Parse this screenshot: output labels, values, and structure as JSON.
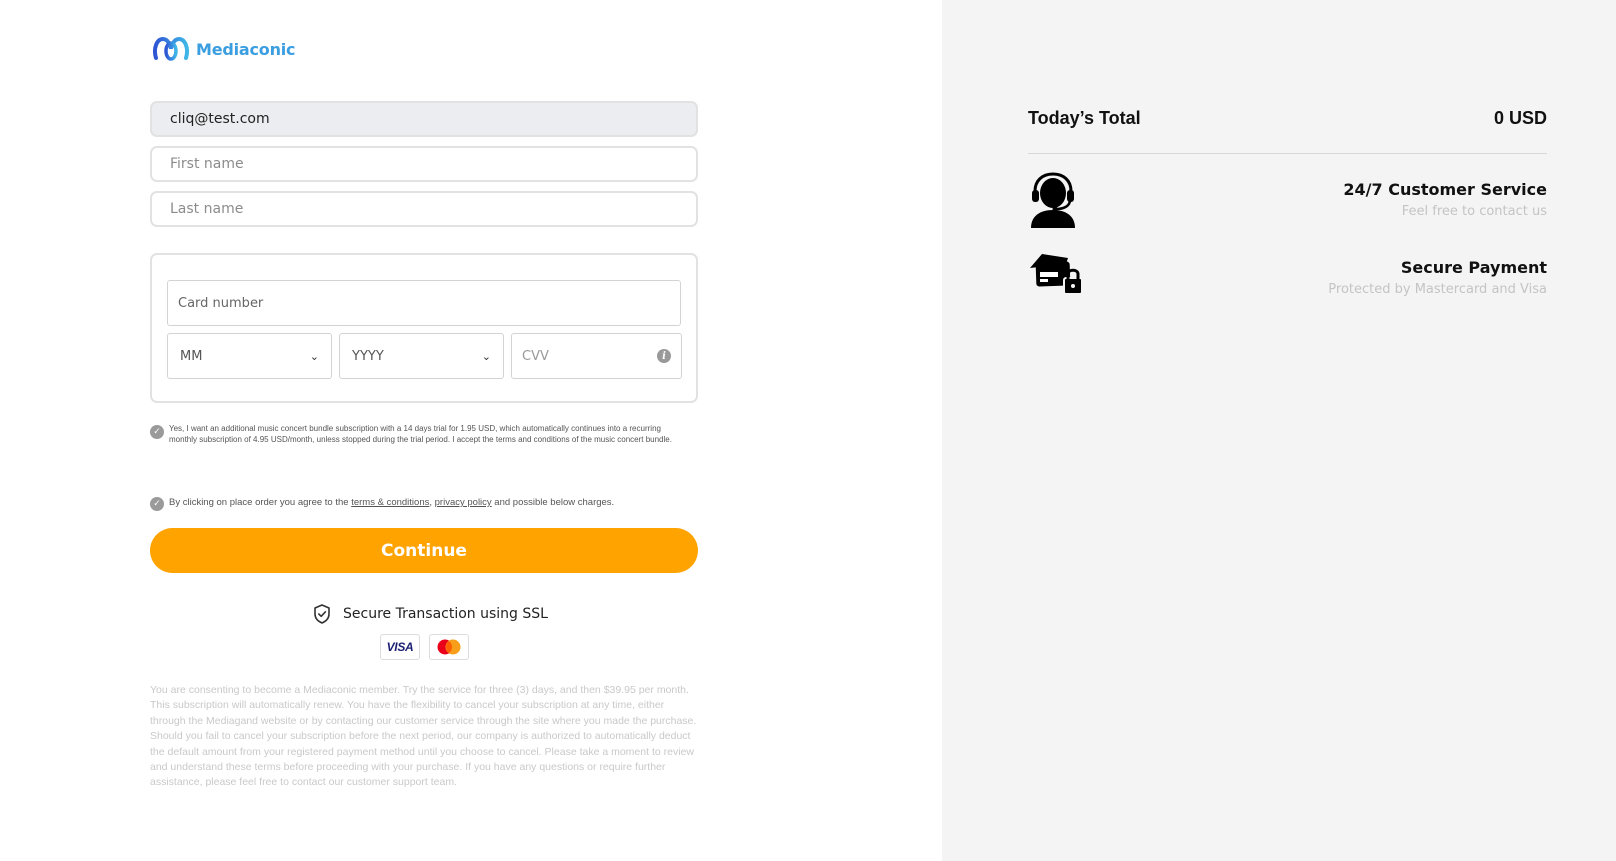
{
  "brand": {
    "name": "Mediaconic",
    "color": "#3a9ee0"
  },
  "form": {
    "email_value": "cliq@test.com",
    "first_name_placeholder": "First name",
    "last_name_placeholder": "Last name",
    "card": {
      "number_placeholder": "Card number",
      "month_value": "MM",
      "year_value": "YYYY",
      "cvv_placeholder": "CVV"
    },
    "bundle_consent": "Yes, I want an additional music concert bundle subscription with a 14 days trial for 1.95 USD, which automatically continues into a recurring monthly subscription of 4.95 USD/month, unless stopped during the trial period. I accept the terms and conditions of the music concert bundle.",
    "terms": {
      "prefix": "By clicking on place order you agree to the ",
      "terms_link": "terms & conditions",
      "separator": ", ",
      "privacy_link": "privacy policy",
      "suffix": " and possible below charges."
    },
    "continue_label": "Continue",
    "continue_color": "#ffa300"
  },
  "security": {
    "ssl_label": "Secure Transaction using SSL",
    "visa_label": "VISA",
    "icons": [
      "shield-check-icon",
      "visa-icon",
      "mastercard-icon"
    ]
  },
  "disclaimer": "You are consenting to become a Mediaconic member. Try the service for three (3) days, and then $39.95 per month. This subscription will automatically renew. You have the flexibility to cancel your subscription at any time, either through the Mediagand website or by contacting our customer service through the site where you made the purchase. Should you fail to cancel your subscription before the next period, our company is authorized to automatically deduct the default amount from your registered payment method until you choose to cancel. Please take a moment to review and understand these terms before proceeding with your purchase. If you have any questions or require further assistance, please feel free to contact our customer support team.",
  "summary": {
    "total_label": "Today’s Total",
    "total_value": "0 USD",
    "features": [
      {
        "icon": "headset-agent-icon",
        "title": "24/7 Customer Service",
        "subtitle": "Feel free to contact us"
      },
      {
        "icon": "secure-card-icon",
        "title": "Secure Payment",
        "subtitle": "Protected by Mastercard and Visa"
      }
    ]
  }
}
